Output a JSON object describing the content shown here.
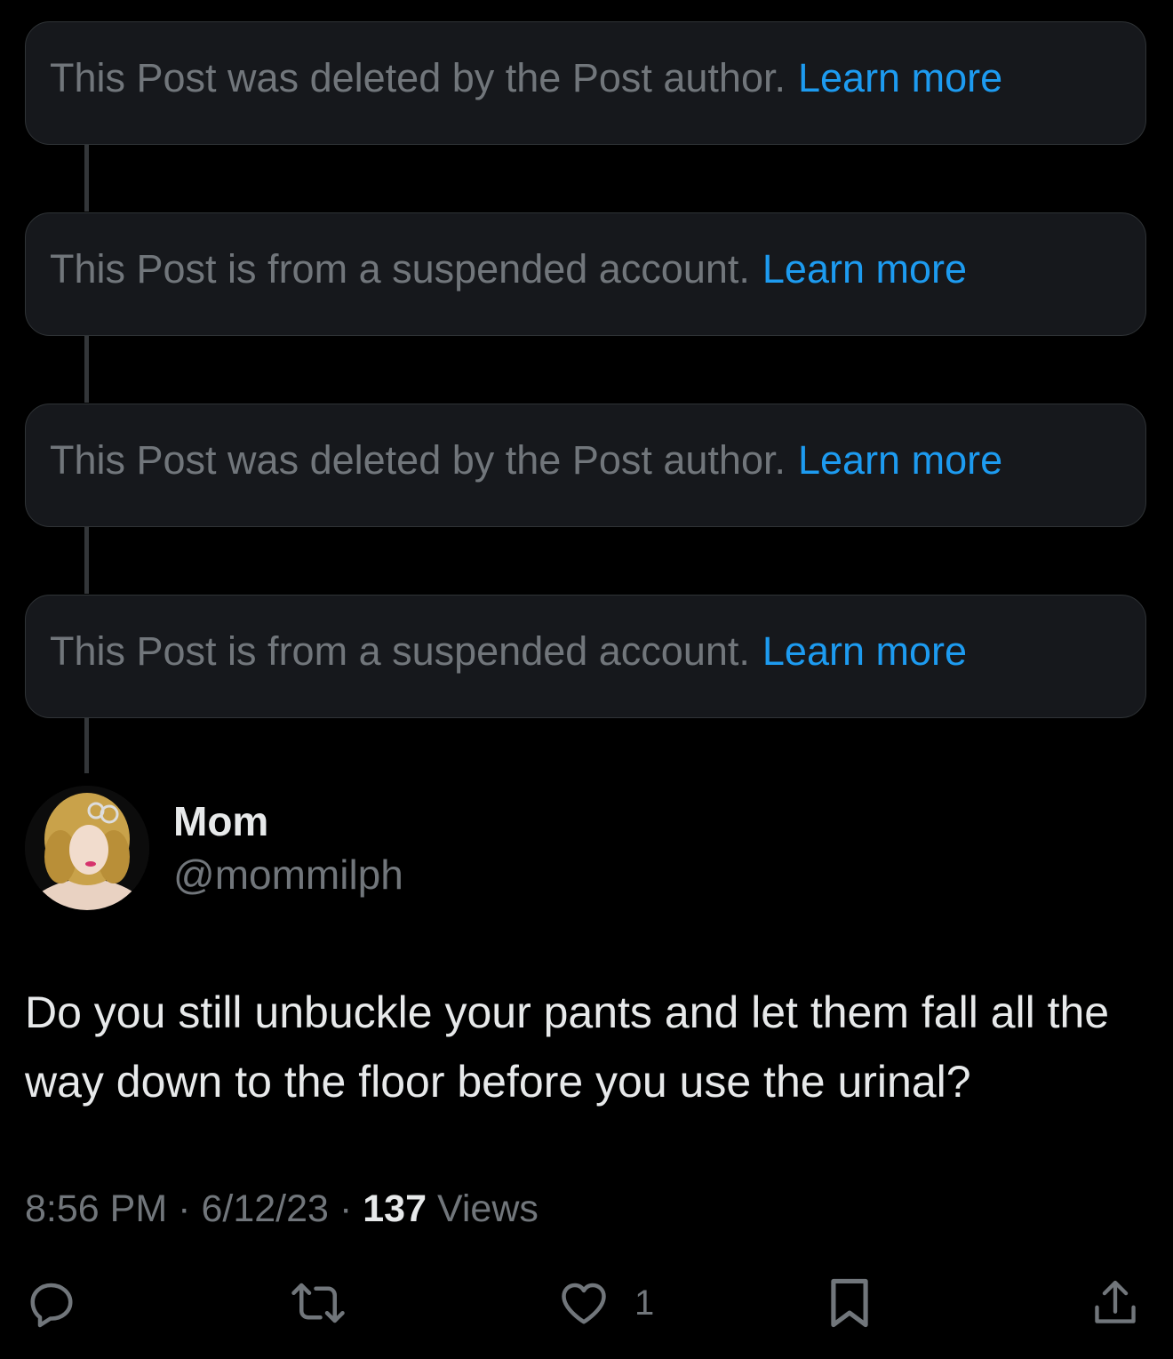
{
  "notices": [
    {
      "text": "This Post was deleted by the Post author.",
      "link": "Learn more"
    },
    {
      "text": "This Post is from a suspended account.",
      "link": "Learn more"
    },
    {
      "text": "This Post was deleted by the Post author.",
      "link": "Learn more"
    },
    {
      "text": "This Post is from a suspended account.",
      "link": "Learn more"
    }
  ],
  "author": {
    "display_name": "Mom",
    "handle": "@mommilph"
  },
  "post": {
    "text": "Do you still unbuckle your pants and let them fall all the way down to the floor before you use the urinal?",
    "time": "8:56 PM",
    "date": "6/12/23",
    "views_count": "137",
    "views_label": "Views",
    "separator": "·"
  },
  "actions": {
    "reply_icon": "reply-icon",
    "repost_icon": "repost-icon",
    "like_icon": "heart-icon",
    "like_count": "1",
    "bookmark_icon": "bookmark-icon",
    "share_icon": "share-icon"
  },
  "colors": {
    "background": "#000000",
    "card": "#16181c",
    "link": "#1d9bf0",
    "muted": "#71767b",
    "text": "#e7e9ea"
  }
}
